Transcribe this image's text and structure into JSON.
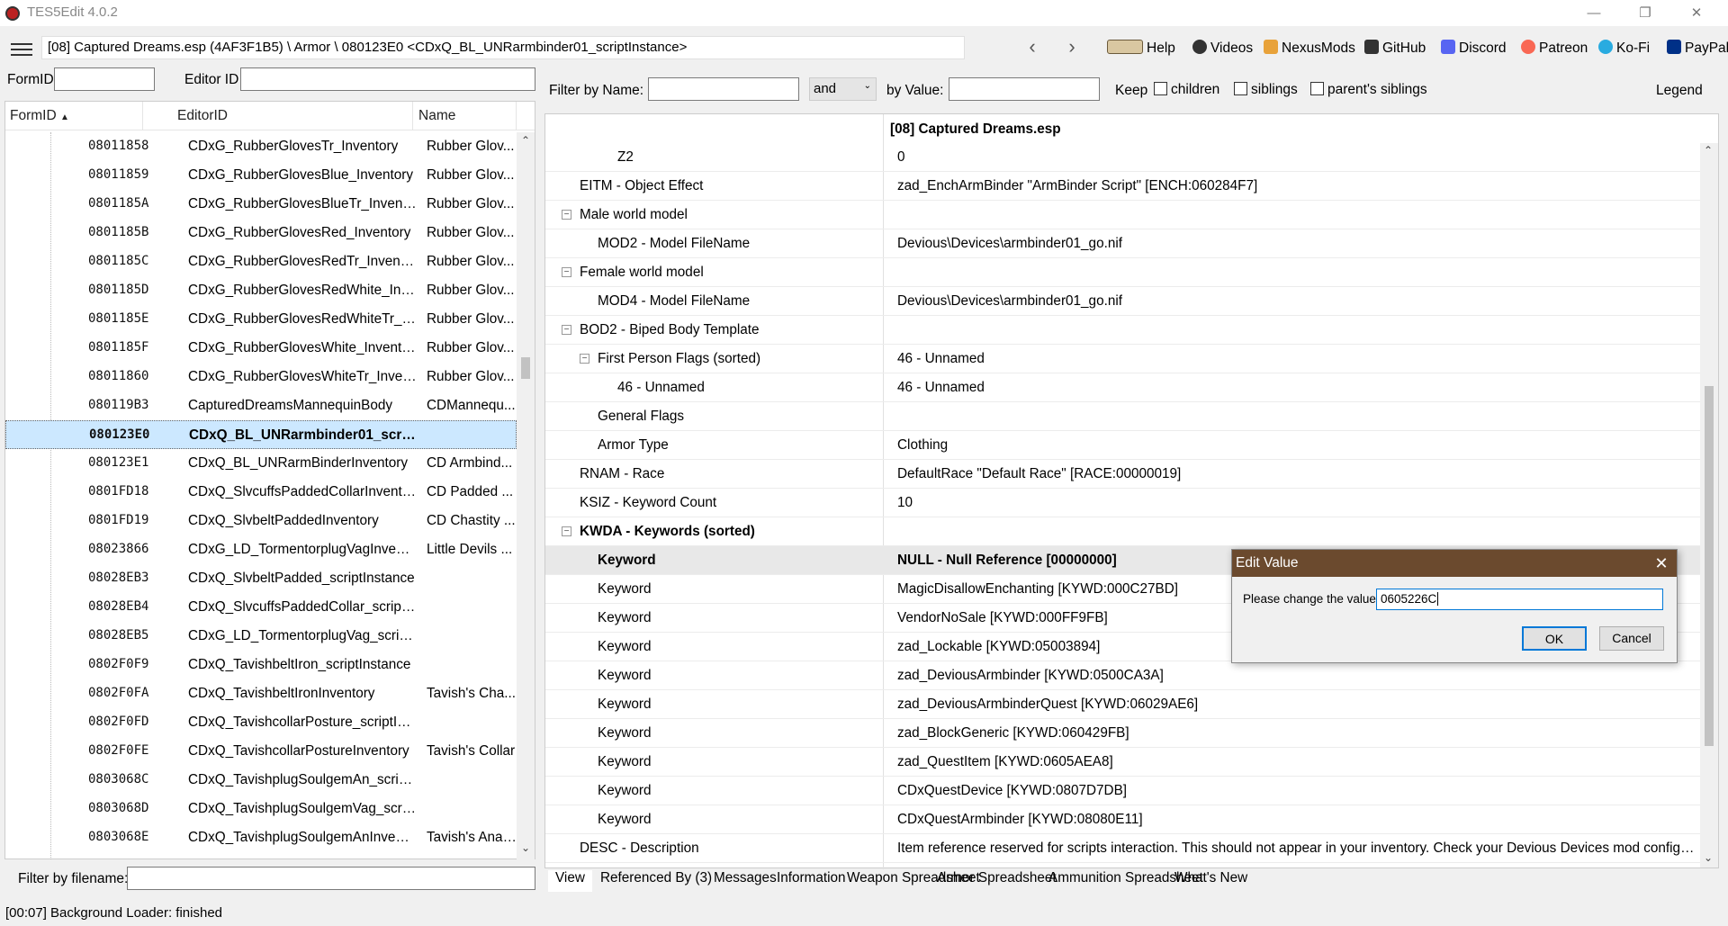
{
  "window": {
    "title": "TES5Edit 4.0.2",
    "minimize": "—",
    "restore": "❐",
    "close": "✕"
  },
  "toolbar": {
    "path": "[08] Captured Dreams.esp (4AF3F1B5) \\ Armor \\ 080123E0 <CDxQ_BL_UNRarmbinder01_scriptInstance>",
    "back": "‹",
    "forward": "›",
    "links": [
      "Help",
      "Videos",
      "NexusMods",
      "GitHub",
      "Discord",
      "Patreon",
      "Ko-Fi",
      "PayPal"
    ]
  },
  "left": {
    "formid_label": "FormID",
    "editorid_label": "Editor ID",
    "columns": [
      "FormID",
      "EditorID",
      "Name"
    ],
    "filter_label": "Filter by filename:",
    "rows": [
      [
        "08011858",
        "CDxG_RubberGlovesTr_Inventory",
        "Rubber Glov..."
      ],
      [
        "08011859",
        "CDxG_RubberGlovesBlue_Inventory",
        "Rubber Glov..."
      ],
      [
        "0801185A",
        "CDxG_RubberGlovesBlueTr_Inventory",
        "Rubber Glov..."
      ],
      [
        "0801185B",
        "CDxG_RubberGlovesRed_Inventory",
        "Rubber Glov..."
      ],
      [
        "0801185C",
        "CDxG_RubberGlovesRedTr_Inventory",
        "Rubber Glov..."
      ],
      [
        "0801185D",
        "CDxG_RubberGlovesRedWhite_Inve...",
        "Rubber Glov..."
      ],
      [
        "0801185E",
        "CDxG_RubberGlovesRedWhiteTr_In...",
        "Rubber Glov..."
      ],
      [
        "0801185F",
        "CDxG_RubberGlovesWhite_Inventory",
        "Rubber Glov..."
      ],
      [
        "08011860",
        "CDxG_RubberGlovesWhiteTr_Invent...",
        "Rubber Glov..."
      ],
      [
        "080119B3",
        "CapturedDreamsMannequinBody",
        "CDMannequ..."
      ],
      [
        "080123E0",
        "CDxQ_BL_UNRarmbinder01_scriptInstance",
        ""
      ],
      [
        "080123E1",
        "CDxQ_BL_UNRarmBinderInventory",
        "CD Armbind..."
      ],
      [
        "0801FD18",
        "CDxQ_SlvcuffsPaddedCollarInvento...",
        "CD Padded ..."
      ],
      [
        "0801FD19",
        "CDxQ_SlvbeltPaddedInventory",
        "CD Chastity ..."
      ],
      [
        "08023866",
        "CDxG_LD_TormentorplugVagInvent...",
        "Little Devils ..."
      ],
      [
        "08028EB3",
        "CDxQ_SlvbeltPadded_scriptInstance",
        ""
      ],
      [
        "08028EB4",
        "CDxQ_SlvcuffsPaddedCollar_scriptInstance",
        ""
      ],
      [
        "08028EB5",
        "CDxG_LD_TormentorplugVag_scriptInstance",
        ""
      ],
      [
        "0802F0F9",
        "CDxQ_TavishbeltIron_scriptInstance",
        ""
      ],
      [
        "0802F0FA",
        "CDxQ_TavishbeltIronInventory",
        "Tavish's Cha..."
      ],
      [
        "0802F0FD",
        "CDxQ_TavishcollarPosture_scriptInstance",
        ""
      ],
      [
        "0802F0FE",
        "CDxQ_TavishcollarPostureInventory",
        "Tavish's Collar"
      ],
      [
        "0803068C",
        "CDxQ_TavishplugSoulgemAn_scriptInstance",
        ""
      ],
      [
        "0803068D",
        "CDxQ_TavishplugSoulgemVag_scriptInstance",
        ""
      ],
      [
        "0803068E",
        "CDxQ_TavishplugSoulgemAnInvent...",
        "Tavish's Anal..."
      ]
    ]
  },
  "filter": {
    "by_name": "Filter by Name:",
    "op": "and",
    "by_value": "by Value:",
    "keep": "Keep",
    "children": "children",
    "siblings": "siblings",
    "parents": "parent's siblings",
    "legend": "Legend"
  },
  "right": {
    "header": "[08] Captured Dreams.esp",
    "rows": [
      {
        "n": "Z2",
        "v": "0",
        "ind": 3
      },
      {
        "n": "EITM - Object Effect",
        "v": "zad_EnchArmBinder \"ArmBinder Script\" [ENCH:060284F7]",
        "ind": 1
      },
      {
        "n": "Male world model",
        "v": "",
        "ind": 1,
        "exp": "⊟"
      },
      {
        "n": "MOD2 - Model FileName",
        "v": "Devious\\Devices\\armbinder01_go.nif",
        "ind": 2
      },
      {
        "n": "Female world model",
        "v": "",
        "ind": 1,
        "exp": "⊟"
      },
      {
        "n": "MOD4 - Model FileName",
        "v": "Devious\\Devices\\armbinder01_go.nif",
        "ind": 2
      },
      {
        "n": "BOD2 - Biped Body Template",
        "v": "",
        "ind": 1,
        "exp": "⊟"
      },
      {
        "n": "First Person Flags (sorted)",
        "v": "46 - Unnamed",
        "ind": 2,
        "exp": "⊟"
      },
      {
        "n": "46 - Unnamed",
        "v": "46 - Unnamed",
        "ind": 3
      },
      {
        "n": "General Flags",
        "v": "",
        "ind": 2
      },
      {
        "n": "Armor Type",
        "v": "Clothing",
        "ind": 2
      },
      {
        "n": "RNAM - Race",
        "v": "DefaultRace \"Default Race\" [RACE:00000019]",
        "ind": 1
      },
      {
        "n": "KSIZ - Keyword Count",
        "v": "10",
        "ind": 1
      },
      {
        "n": "KWDA - Keywords (sorted)",
        "v": "",
        "ind": 1,
        "exp": "⊟",
        "b": true
      },
      {
        "n": "Keyword",
        "v": "NULL - Null Reference [00000000]",
        "ind": 2,
        "b": true,
        "hl": true
      },
      {
        "n": "Keyword",
        "v": "MagicDisallowEnchanting [KYWD:000C27BD]",
        "ind": 2
      },
      {
        "n": "Keyword",
        "v": "VendorNoSale [KYWD:000FF9FB]",
        "ind": 2
      },
      {
        "n": "Keyword",
        "v": "zad_Lockable [KYWD:05003894]",
        "ind": 2
      },
      {
        "n": "Keyword",
        "v": "zad_DeviousArmbinder [KYWD:0500CA3A]",
        "ind": 2
      },
      {
        "n": "Keyword",
        "v": "zad_DeviousArmbinderQuest [KYWD:06029AE6]",
        "ind": 2
      },
      {
        "n": "Keyword",
        "v": "zad_BlockGeneric [KYWD:060429FB]",
        "ind": 2
      },
      {
        "n": "Keyword",
        "v": "zad_QuestItem [KYWD:0605AEA8]",
        "ind": 2
      },
      {
        "n": "Keyword",
        "v": "CDxQuestDevice [KYWD:0807D7DB]",
        "ind": 2
      },
      {
        "n": "Keyword",
        "v": "CDxQuestArmbinder [KYWD:08080E11]",
        "ind": 2
      },
      {
        "n": "DESC - Description",
        "v": "Item reference reserved for scripts interaction. This should not appear in your inventory. Check your Devious Devices mod configurati...",
        "ind": 1
      }
    ]
  },
  "tabs": [
    "View",
    "Referenced By (3)",
    "Messages",
    "Information",
    "Weapon Spreadsheet",
    "Armor Spreadsheet",
    "Ammunition Spreadsheet",
    "What's New"
  ],
  "status": "[00:07] Background Loader: finished",
  "dialog": {
    "title": "Edit Value",
    "prompt": "Please change the value:",
    "value": "0605226C",
    "ok": "OK",
    "cancel": "Cancel"
  }
}
